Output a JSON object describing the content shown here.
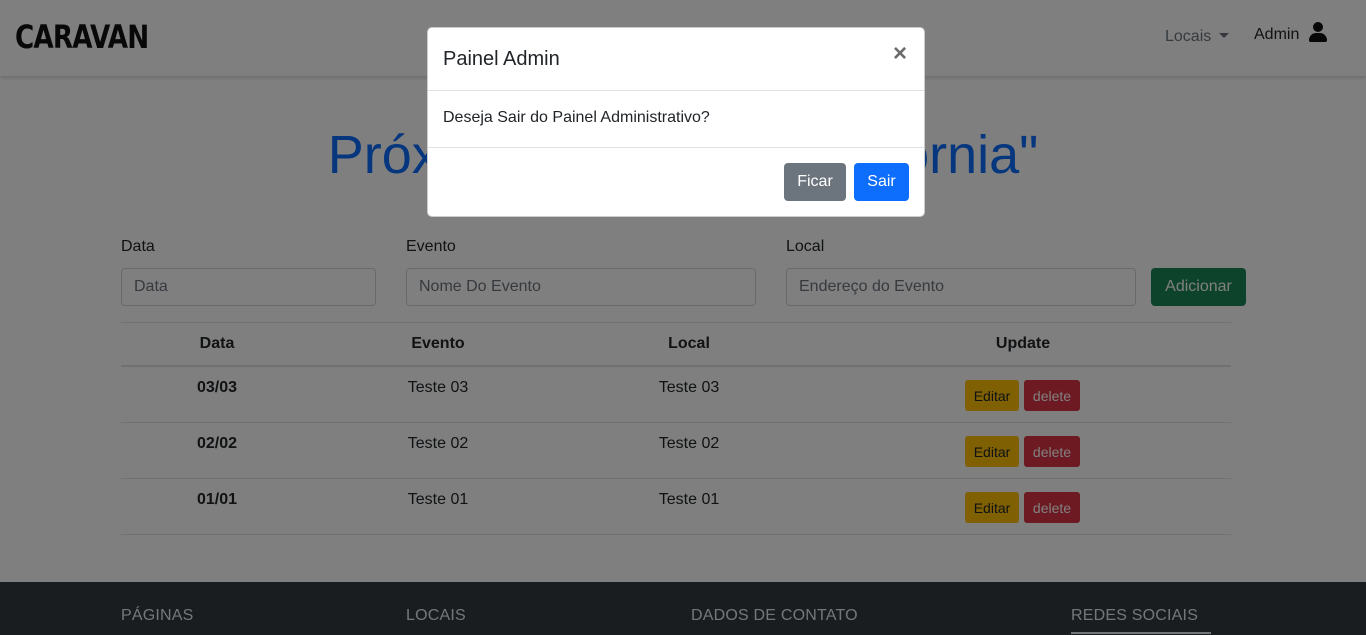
{
  "navbar": {
    "brand": "CARAVAN",
    "locais_label": "Locais",
    "admin_label": "Admin"
  },
  "heading": "Próximos eventos \"Califórnia\"",
  "form": {
    "data_label": "Data",
    "data_placeholder": "Data",
    "evento_label": "Evento",
    "evento_placeholder": "Nome Do Evento",
    "local_label": "Local",
    "local_placeholder": "Endereço do Evento",
    "add_button": "Adicionar"
  },
  "table": {
    "headers": [
      "Data",
      "Evento",
      "Local",
      "Update"
    ],
    "rows": [
      {
        "data": "03/03",
        "evento": "Teste 03",
        "local": "Teste 03"
      },
      {
        "data": "02/02",
        "evento": "Teste 02",
        "local": "Teste 02"
      },
      {
        "data": "01/01",
        "evento": "Teste 01",
        "local": "Teste 01"
      }
    ],
    "edit_label": "Editar",
    "delete_label": "delete"
  },
  "footer": {
    "columns": [
      "PÁGINAS",
      "LOCAIS",
      "DADOS DE CONTATO",
      "REDES SOCIAIS"
    ]
  },
  "modal": {
    "title": "Painel Admin",
    "close": "×",
    "message": "Deseja Sair do Painel Administrativo?",
    "stay_button": "Ficar",
    "leave_button": "Sair"
  },
  "colors": {
    "primary": "#0d6efd",
    "success": "#198754",
    "warning": "#ffc107",
    "danger": "#dc3545",
    "secondary": "#6c757d",
    "footer_bg": "#343a40"
  },
  "icons": {
    "user": "user-icon",
    "dropdown": "caret-down-icon",
    "close": "close-icon"
  }
}
